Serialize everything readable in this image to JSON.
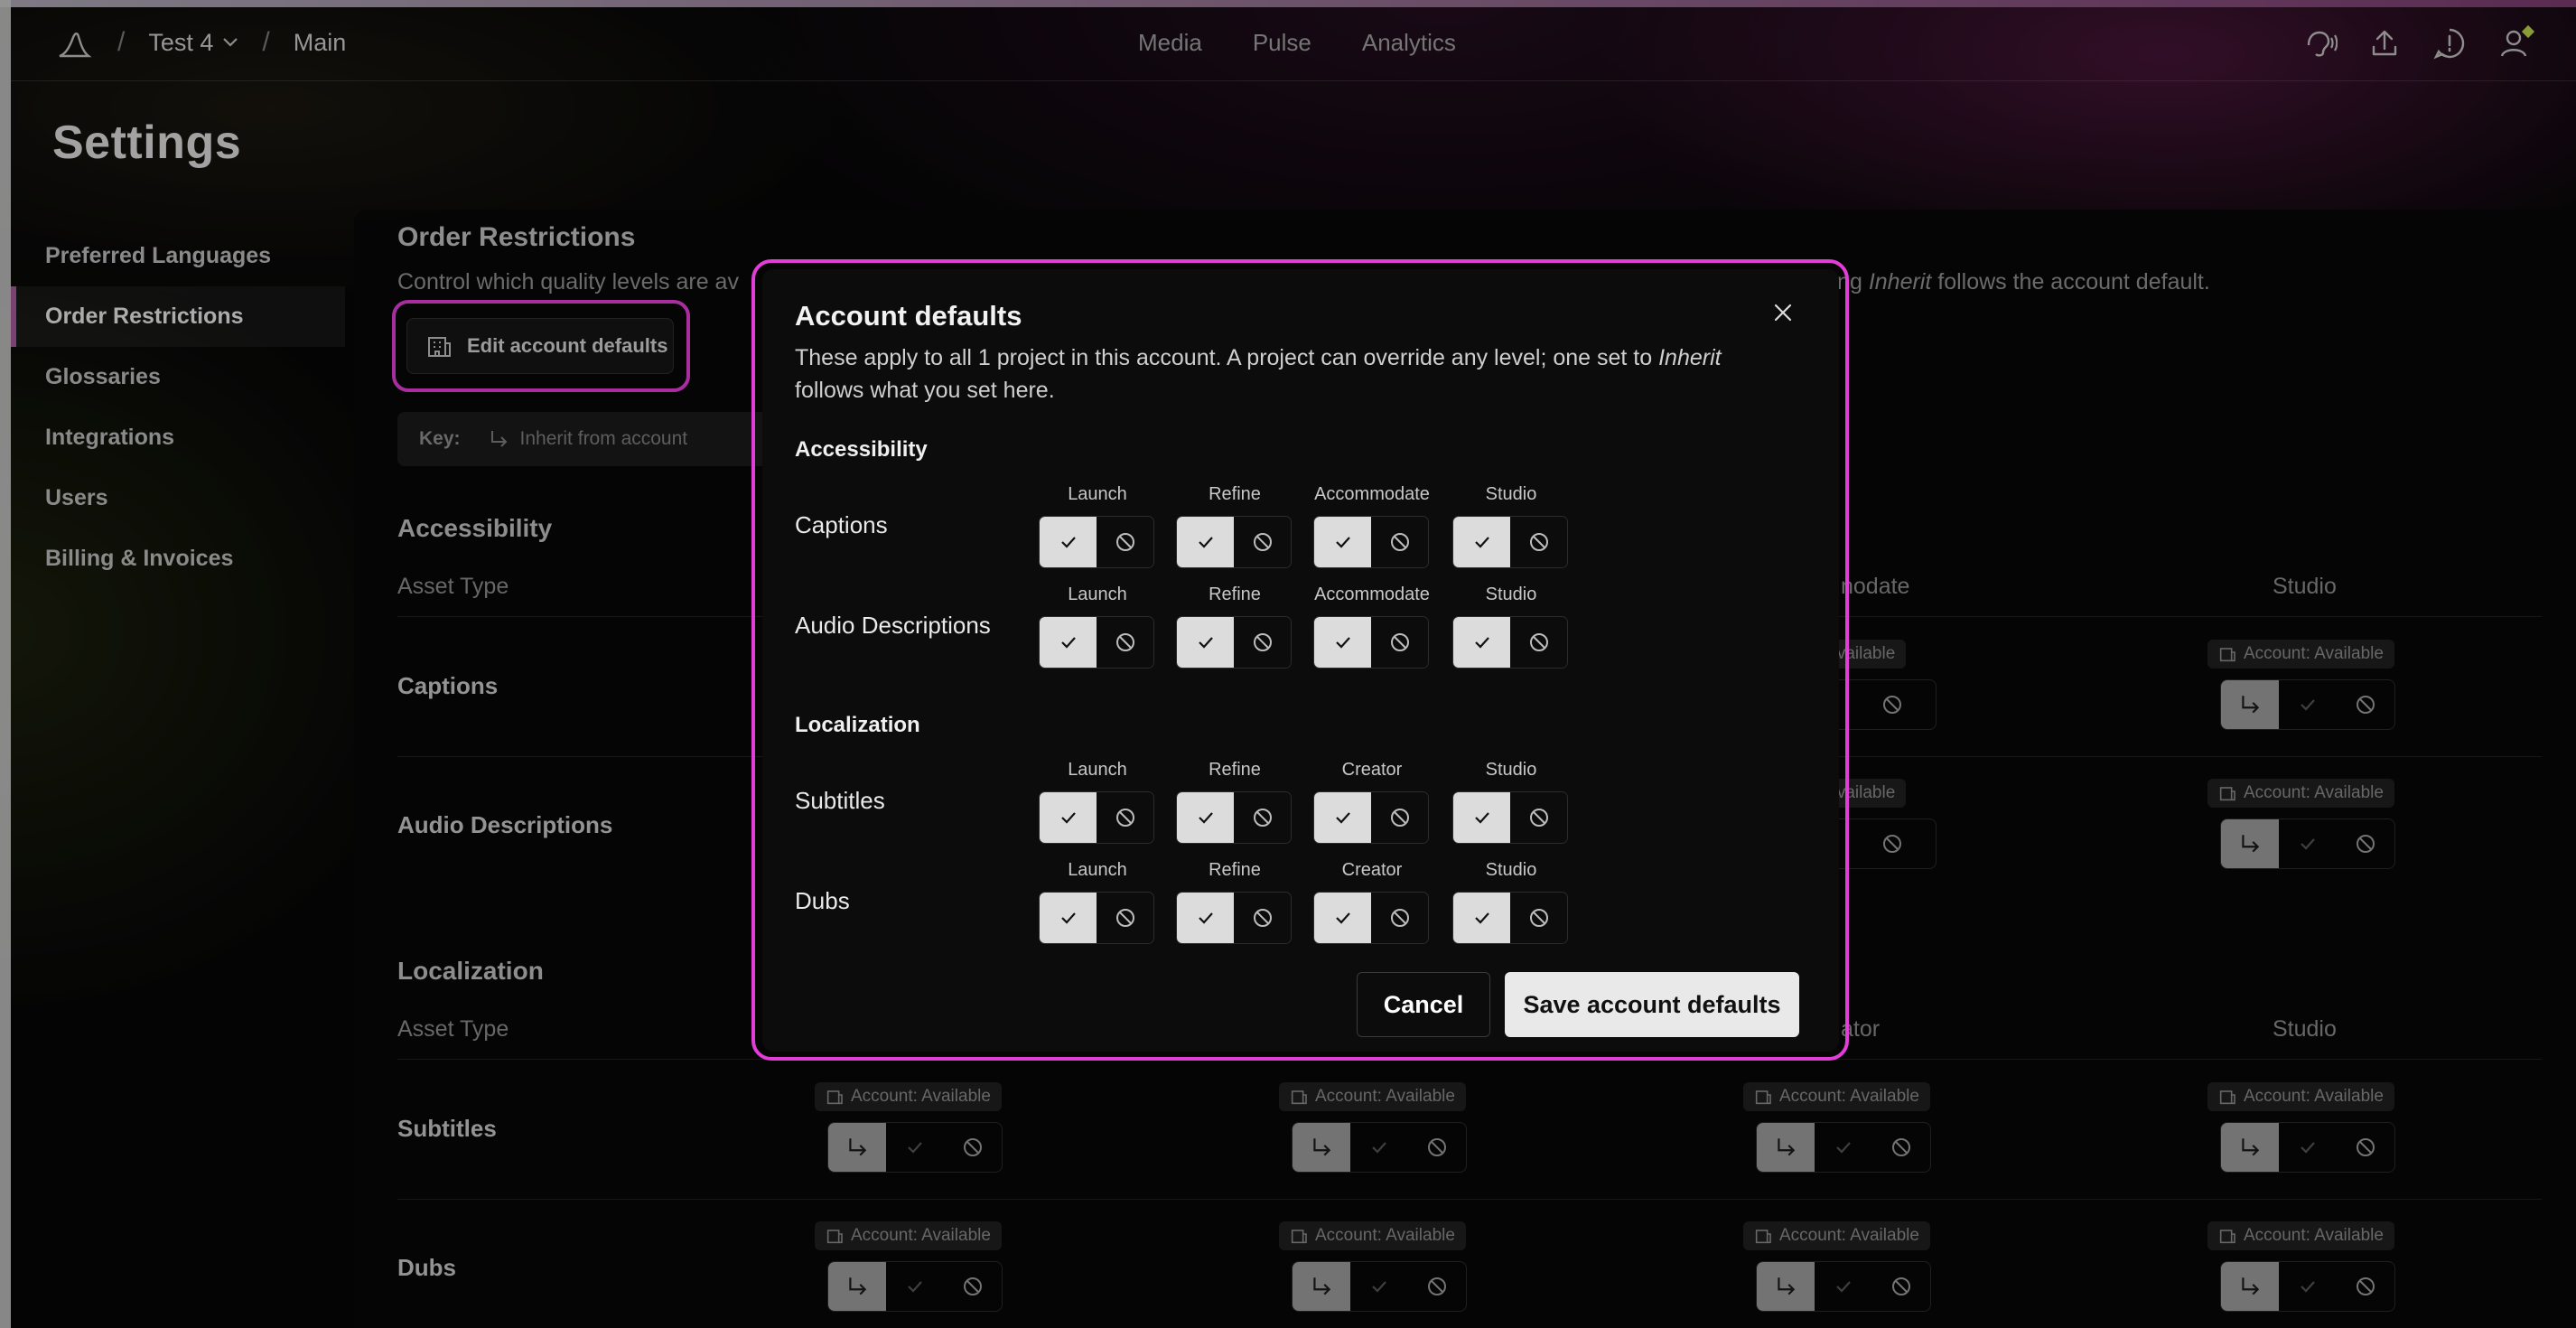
{
  "breadcrumb": {
    "project": "Test 4",
    "branch": "Main"
  },
  "topnav": [
    "Media",
    "Pulse",
    "Analytics"
  ],
  "settings": {
    "title": "Settings",
    "sidebar": [
      "Preferred Languages",
      "Order Restrictions",
      "Glossaries",
      "Integrations",
      "Users",
      "Billing & Invoices"
    ]
  },
  "panel": {
    "title": "Order Restrictions",
    "desc_left": "Control which quality levels are av",
    "desc_right_prefix": "sing ",
    "desc_right_italic": "Inherit",
    "desc_right_suffix": " follows the account default.",
    "edit_button": "Edit account defaults",
    "key_label": "Key:",
    "key_value": "Inherit from account",
    "accessibility": {
      "title": "Accessibility",
      "asset_type": "Asset Type",
      "col_partial": "nodate",
      "col_studio": "Studio",
      "rows": [
        "Captions",
        "Audio Descriptions"
      ]
    },
    "localization": {
      "title": "Localization",
      "asset_type": "Asset Type",
      "col_partial": "ator",
      "col_studio": "Studio",
      "rows": [
        "Subtitles",
        "Dubs"
      ]
    },
    "badge_full": "Account: Available",
    "badge_partial": ": Available"
  },
  "modal": {
    "title": "Account defaults",
    "desc_part1": "These apply to all 1 project in this account. A project can override any level; one set to ",
    "desc_italic": "Inherit",
    "desc_part2": " follows what you set here.",
    "sections": [
      {
        "title": "Accessibility",
        "rows": [
          {
            "label": "Captions",
            "levels": [
              "Launch",
              "Refine",
              "Accommodate",
              "Studio"
            ]
          },
          {
            "label": "Audio Descriptions",
            "levels": [
              "Launch",
              "Refine",
              "Accommodate",
              "Studio"
            ]
          }
        ]
      },
      {
        "title": "Localization",
        "rows": [
          {
            "label": "Subtitles",
            "levels": [
              "Launch",
              "Refine",
              "Creator",
              "Studio"
            ]
          },
          {
            "label": "Dubs",
            "levels": [
              "Launch",
              "Refine",
              "Creator",
              "Studio"
            ]
          }
        ]
      }
    ],
    "cancel": "Cancel",
    "save": "Save account defaults"
  },
  "colors": {
    "highlight": "#e03ed6",
    "accent_dot": "#b5d14a",
    "sidebar_active_bar": "#a05a9a"
  },
  "icons": [
    "app-logo-icon",
    "chevron-down-icon",
    "audio-icon",
    "upload-icon",
    "feedback-icon",
    "user-icon",
    "building-icon",
    "inherit-arrow-icon",
    "check-icon",
    "ban-icon",
    "close-icon"
  ]
}
